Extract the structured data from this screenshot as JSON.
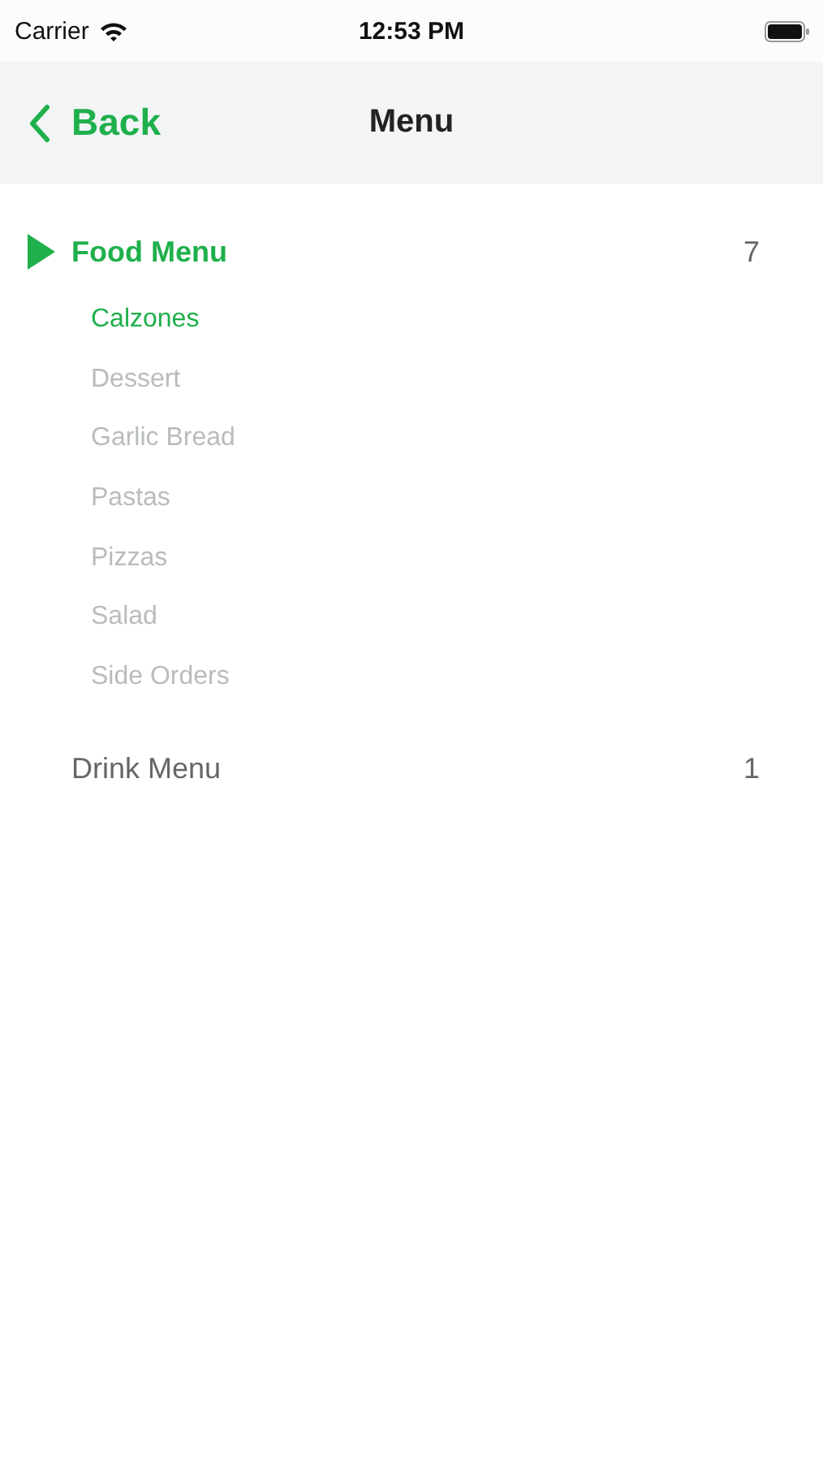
{
  "status_bar": {
    "carrier": "Carrier",
    "time": "12:53 PM"
  },
  "nav_bar": {
    "back": "Back",
    "title": "Menu"
  },
  "categories": [
    {
      "label": "Food Menu",
      "count": "7",
      "selected": true,
      "expanded": true,
      "children": [
        {
          "label": "Calzones",
          "selected": true
        },
        {
          "label": "Dessert",
          "selected": false
        },
        {
          "label": "Garlic Bread",
          "selected": false
        },
        {
          "label": "Pastas",
          "selected": false
        },
        {
          "label": "Pizzas",
          "selected": false
        },
        {
          "label": "Salad",
          "selected": false
        },
        {
          "label": "Side Orders",
          "selected": false
        }
      ]
    },
    {
      "label": "Drink Menu",
      "count": "1",
      "selected": false,
      "expanded": false
    }
  ]
}
